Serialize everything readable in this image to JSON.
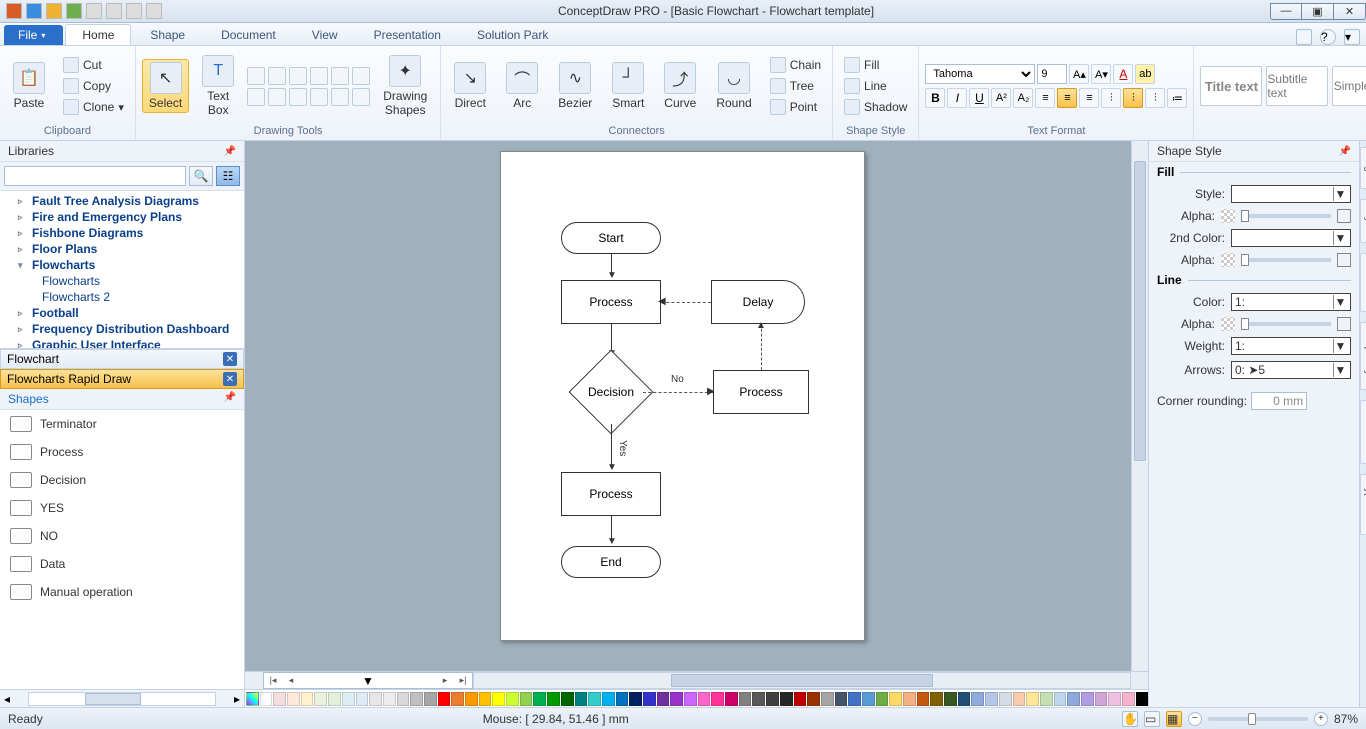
{
  "title": "ConceptDraw PRO - [Basic Flowchart - Flowchart template]",
  "menu": {
    "file": "File",
    "tabs": [
      "Home",
      "Shape",
      "Document",
      "View",
      "Presentation",
      "Solution Park"
    ],
    "active": 0
  },
  "ribbon": {
    "clipboard": {
      "label": "Clipboard",
      "paste": "Paste",
      "cut": "Cut",
      "copy": "Copy",
      "clone": "Clone"
    },
    "drawing": {
      "label": "Drawing Tools",
      "select": "Select",
      "textbox": "Text\nBox",
      "shapes": "Drawing\nShapes"
    },
    "connectors": {
      "label": "Connectors",
      "items": [
        "Direct",
        "Arc",
        "Bezier",
        "Smart",
        "Curve",
        "Round"
      ],
      "chain": "Chain",
      "tree": "Tree",
      "point": "Point"
    },
    "shapestyle": {
      "label": "Shape Style",
      "fill": "Fill",
      "line": "Line",
      "shadow": "Shadow"
    },
    "textformat": {
      "label": "Text Format",
      "font": "Tahoma",
      "size": "9"
    },
    "titles": {
      "title": "Title text",
      "subtitle": "Subtitle text",
      "simple": "Simple text"
    }
  },
  "libraries": {
    "header": "Libraries",
    "tree": [
      {
        "t": "Fault Tree Analysis Diagrams",
        "e": "▹"
      },
      {
        "t": "Fire and Emergency Plans",
        "e": "▹"
      },
      {
        "t": "Fishbone Diagrams",
        "e": "▹"
      },
      {
        "t": "Floor Plans",
        "e": "▹"
      },
      {
        "t": "Flowcharts",
        "e": "▾",
        "children": [
          {
            "t": "Flowcharts"
          },
          {
            "t": "Flowcharts 2"
          }
        ]
      },
      {
        "t": "Football",
        "e": "▹"
      },
      {
        "t": "Frequency Distribution Dashboard",
        "e": "▹"
      },
      {
        "t": "Graphic User Interface",
        "e": "▹"
      }
    ],
    "tabs": [
      {
        "t": "Flowchart",
        "sel": false
      },
      {
        "t": "Flowcharts Rapid Draw",
        "sel": true
      }
    ],
    "shapes_hdr": "Shapes",
    "shapes": [
      "Terminator",
      "Process",
      "Decision",
      "YES",
      "NO",
      "Data",
      "Manual operation"
    ]
  },
  "flow": {
    "start": "Start",
    "process": "Process",
    "delay": "Delay",
    "decision": "Decision",
    "end": "End",
    "no": "No",
    "yes": "Yes"
  },
  "rightpanel": {
    "header": "Shape Style",
    "fill": "Fill",
    "line": "Line",
    "style": "Style:",
    "alpha": "Alpha:",
    "color2": "2nd Color:",
    "color": "Color:",
    "weight": "Weight:",
    "arrows": "Arrows:",
    "corner": "Corner rounding:",
    "corner_val": "0 mm",
    "weight_val": "1:",
    "color_val": "1:",
    "arrows_val": "0:             ➤5",
    "tabs": [
      "Pages",
      "Layers",
      "Behaviour",
      "Shape Style",
      "Information",
      "Hypernote"
    ]
  },
  "status": {
    "ready": "Ready",
    "mouse": "Mouse: [ 29.84, 51.46 ] mm",
    "zoom": "87%"
  },
  "palette": [
    "#ffffff",
    "#f2dede",
    "#fde9d9",
    "#fff2cc",
    "#eaf1dd",
    "#e2efda",
    "#daeef3",
    "#deebf6",
    "#e7e6e6",
    "#ededed",
    "#d9d9d9",
    "#bfbfbf",
    "#a6a6a6",
    "#ff0000",
    "#ed7d31",
    "#ff9900",
    "#ffc000",
    "#ffff00",
    "#ccff33",
    "#92d050",
    "#00b050",
    "#009900",
    "#006600",
    "#008080",
    "#33cccc",
    "#00b0f0",
    "#0070c0",
    "#002060",
    "#3333cc",
    "#7030a0",
    "#9933cc",
    "#cc66ff",
    "#ff66cc",
    "#ff3399",
    "#cc0066",
    "#808080",
    "#595959",
    "#404040",
    "#262626",
    "#c00000",
    "#993300",
    "#a5a5a5",
    "#44546a",
    "#4472c4",
    "#5b9bd5",
    "#70ad47",
    "#ffd966",
    "#f4b084",
    "#c65911",
    "#806000",
    "#385723",
    "#1f4e79",
    "#8faadc",
    "#b4c7e7",
    "#d6dce5",
    "#f8cbad",
    "#ffe699",
    "#c5e0b4",
    "#bdd7ee",
    "#8ea9db",
    "#b09ee0",
    "#d0a6d6",
    "#eec1e3",
    "#f5b3cf",
    "#000000"
  ]
}
